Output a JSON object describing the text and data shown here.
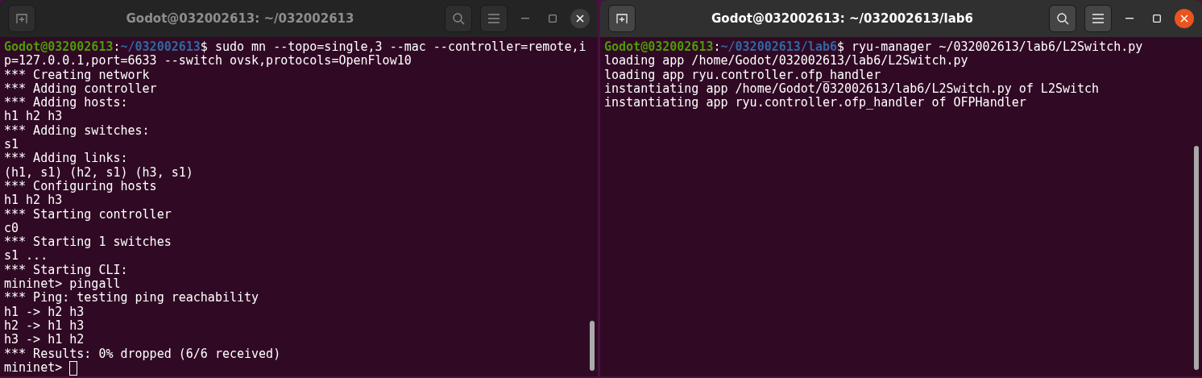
{
  "terminals": [
    {
      "title": "Godot@032002613: ~/032002613",
      "active": false,
      "lines": [
        {
          "kind": "prompt",
          "user": "Godot@032002613",
          "separator": ":",
          "path": "~/032002613",
          "command": "$ sudo mn --topo=single,3 --mac --controller=remote,i"
        },
        {
          "kind": "output",
          "text": "p=127.0.0.1,port=6633 --switch ovsk,protocols=OpenFlow10"
        },
        {
          "kind": "output",
          "text": "*** Creating network"
        },
        {
          "kind": "output",
          "text": "*** Adding controller"
        },
        {
          "kind": "output",
          "text": "*** Adding hosts:"
        },
        {
          "kind": "output",
          "text": "h1 h2 h3"
        },
        {
          "kind": "output",
          "text": "*** Adding switches:"
        },
        {
          "kind": "output",
          "text": "s1"
        },
        {
          "kind": "output",
          "text": "*** Adding links:"
        },
        {
          "kind": "output",
          "text": "(h1, s1) (h2, s1) (h3, s1)"
        },
        {
          "kind": "output",
          "text": "*** Configuring hosts"
        },
        {
          "kind": "output",
          "text": "h1 h2 h3"
        },
        {
          "kind": "output",
          "text": "*** Starting controller"
        },
        {
          "kind": "output",
          "text": "c0"
        },
        {
          "kind": "output",
          "text": "*** Starting 1 switches"
        },
        {
          "kind": "output",
          "text": "s1 ..."
        },
        {
          "kind": "output",
          "text": "*** Starting CLI:"
        },
        {
          "kind": "output",
          "text": "mininet> pingall"
        },
        {
          "kind": "output",
          "text": "*** Ping: testing ping reachability"
        },
        {
          "kind": "output",
          "text": "h1 -> h2 h3"
        },
        {
          "kind": "output",
          "text": "h2 -> h1 h3"
        },
        {
          "kind": "output",
          "text": "h3 -> h1 h2"
        },
        {
          "kind": "output",
          "text": "*** Results: 0% dropped (6/6 received)"
        },
        {
          "kind": "input",
          "text": "mininet>"
        }
      ]
    },
    {
      "title": "Godot@032002613: ~/032002613/lab6",
      "active": true,
      "lines": [
        {
          "kind": "prompt",
          "user": "Godot@032002613",
          "separator": ":",
          "path": "~/032002613/lab6",
          "command": "$ ryu-manager ~/032002613/lab6/L2Switch.py"
        },
        {
          "kind": "output",
          "text": "loading app /home/Godot/032002613/lab6/L2Switch.py"
        },
        {
          "kind": "output",
          "text": "loading app ryu.controller.ofp_handler"
        },
        {
          "kind": "output",
          "text": "instantiating app /home/Godot/032002613/lab6/L2Switch.py of L2Switch"
        },
        {
          "kind": "output",
          "text": "instantiating app ryu.controller.ofp_handler of OFPHandler"
        }
      ]
    }
  ]
}
